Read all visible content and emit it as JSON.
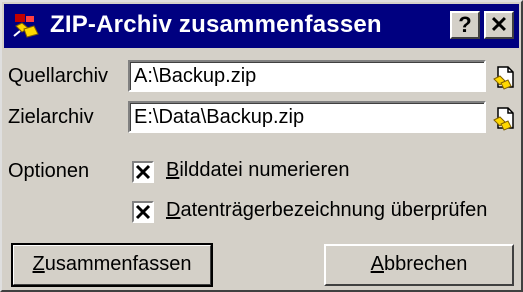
{
  "window": {
    "title": "ZIP-Archiv zusammenfassen",
    "help_label": "?",
    "close_label": "✕"
  },
  "fields": {
    "source_label": "Quellarchiv",
    "source_value": "A:\\Backup.zip",
    "target_label": "Zielarchiv",
    "target_value": "E:\\Data\\Backup.zip"
  },
  "options": {
    "label": "Optionen",
    "number_files": {
      "mnemonic": "B",
      "rest": "ilddatei numerieren",
      "checked": true
    },
    "verify_label": {
      "mnemonic": "D",
      "rest": "atenträgerbezeichnung überprüfen",
      "checked": true
    }
  },
  "buttons": {
    "merge": {
      "mnemonic": "Z",
      "rest": "usammenfassen"
    },
    "cancel": {
      "pre": "",
      "mnemonic": "A",
      "rest": "bbrechen"
    }
  },
  "colors": {
    "titlebar": "#000080",
    "face": "#d4d0c8"
  }
}
